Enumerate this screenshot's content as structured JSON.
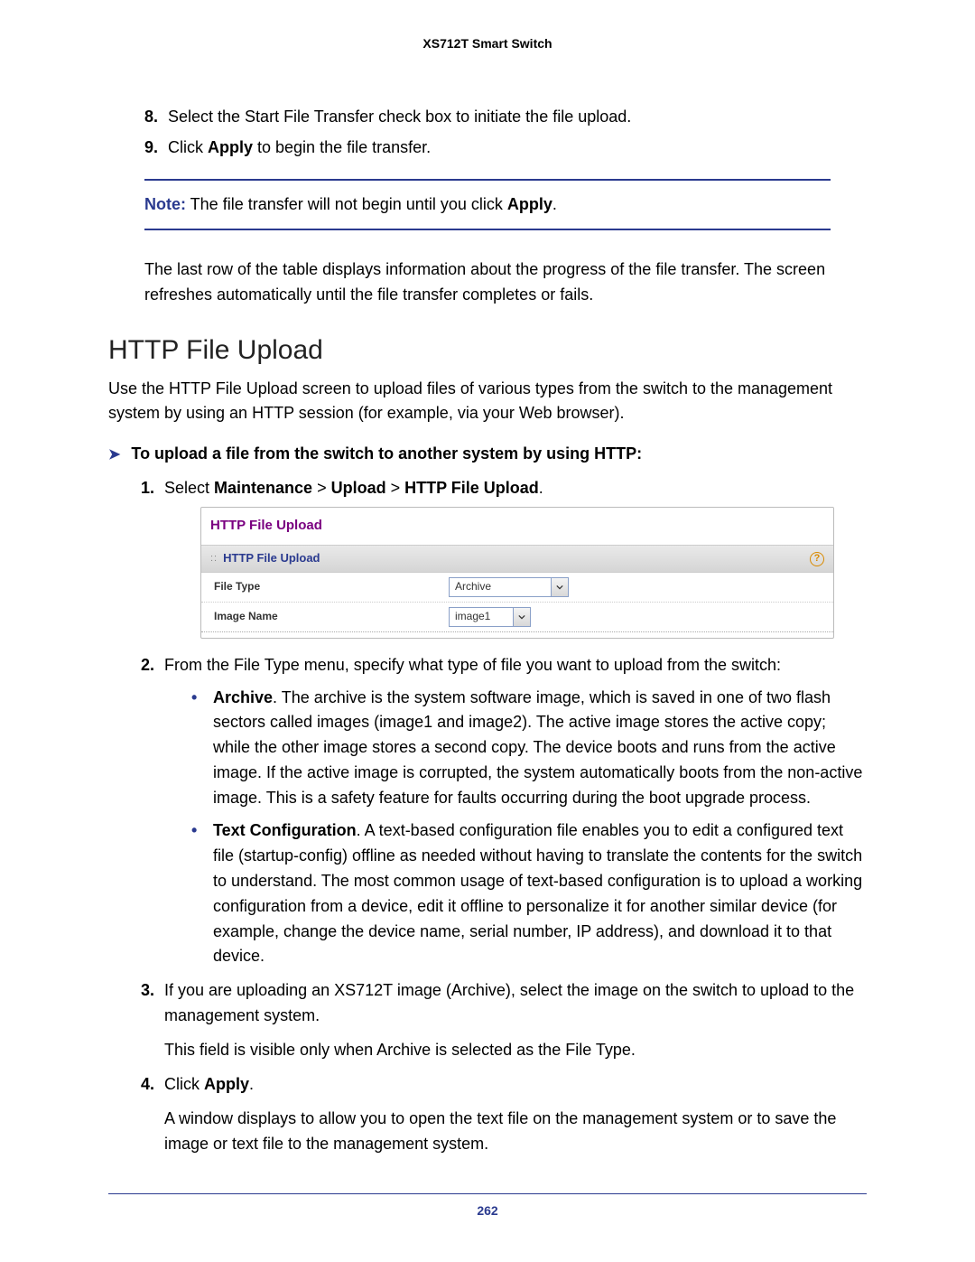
{
  "header": "XS712T Smart Switch",
  "list8": "Select the Start File Transfer check box to initiate the file upload.",
  "list9_a": "Click ",
  "list9_b": "Apply",
  "list9_c": " to begin the file transfer.",
  "note_label": "Note:",
  "note_a": " The file transfer will not begin until you click ",
  "note_b": "Apply",
  "note_c": ".",
  "after_note": "The last row of the table displays information about the progress of the file transfer. The screen refreshes automatically until the file transfer completes or fails.",
  "section": "HTTP File Upload",
  "intro": "Use the HTTP File Upload screen to upload files of various types from the switch to the management system by using an HTTP session (for example, via your Web browser).",
  "proc_head": "To upload a file from the switch to another system by using HTTP:",
  "step1_a": "Select ",
  "step1_b": "Maintenance",
  "step1_c": " > ",
  "step1_d": "Upload",
  "step1_e": " > ",
  "step1_f": "HTTP File Upload",
  "step1_g": ".",
  "ss": {
    "title": "HTTP File Upload",
    "bar": "HTTP File Upload",
    "row1_label": "File Type",
    "row1_value": "Archive",
    "row2_label": "Image Name",
    "row2_value": "image1"
  },
  "step2": "From the File Type menu, specify what type of file you want to upload from the switch:",
  "b1_label": "Archive",
  "b1_text": ". The archive is the system software image, which is saved in one of two flash sectors called images (image1 and image2). The active image stores the active copy; while the other image stores a second copy. The device boots and runs from the active image. If the active image is corrupted, the system automatically boots from the non-active image. This is a safety feature for faults occurring during the boot upgrade process.",
  "b2_label": "Text Configuration",
  "b2_text": ". A text-based configuration file enables you to edit a configured text file (startup-config) offline as needed without having to translate the contents for the switch to understand. The most common usage of text-based configuration is to upload a working configuration from a device, edit it offline to personalize it for another similar device (for example, change the device name, serial number, IP address), and download it to that device.",
  "step3": "If you are uploading an XS712T image (Archive), select the image on the switch to upload to the management system.",
  "step3_sub": "This field is visible only when Archive is selected as the File Type.",
  "step4_a": "Click ",
  "step4_b": "Apply",
  "step4_c": ".",
  "step4_sub": "A window displays to allow you to open the text file on the management system or to save the image or text file to the management system.",
  "page_no": "262"
}
